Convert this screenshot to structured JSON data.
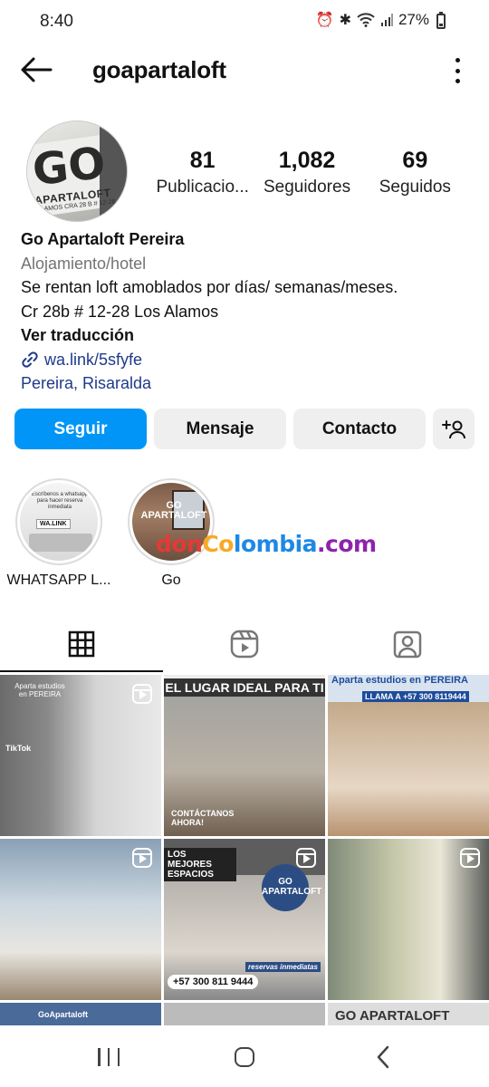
{
  "status": {
    "time": "8:40",
    "battery": "27%"
  },
  "header": {
    "username": "goapartaloft"
  },
  "avatar": {
    "logo_text": "GO",
    "brand": "APARTALOFT",
    "address": "ALAMOS CRA 28 B # 12-28"
  },
  "stats": [
    {
      "value": "81",
      "label": "Publicacio..."
    },
    {
      "value": "1,082",
      "label": "Seguidores"
    },
    {
      "value": "69",
      "label": "Seguidos"
    }
  ],
  "bio": {
    "name": "Go Apartaloft Pereira",
    "category": "Alojamiento/hotel",
    "line1": "Se rentan loft amoblados por días/ semanas/meses.",
    "line2": "Cr 28b # 12-28 Los Alamos",
    "translate": "Ver traducción",
    "link": "wa.link/5sfyfe",
    "location": "Pereira, Risaralda"
  },
  "buttons": {
    "follow": "Seguir",
    "message": "Mensaje",
    "contact": "Contacto"
  },
  "highlights": [
    {
      "label": "WHATSAPP L...",
      "thumb_text": "Escríbenos a whatsapp para hacer reserva inmediata",
      "thumb_badge": "WA.LINK"
    },
    {
      "label": "Go",
      "thumb_text": "GO APARTALOFT"
    }
  ],
  "watermark": {
    "p1": "don",
    "p2": "Co",
    "p3": "lombia",
    "p4": ".com"
  },
  "posts": [
    {
      "caption": "Aparta estudios en PEREIRA",
      "extra": "TikTok"
    },
    {
      "caption": "EL LUGAR IDEAL PARA TI",
      "extra": "CONTÁCTANOS AHORA!"
    },
    {
      "caption": "Aparta estudios en PEREIRA",
      "extra": "LLAMA A +57 300 8119444"
    },
    {
      "caption": "",
      "extra": ""
    },
    {
      "caption": "LOS MEJORES ESPACIOS",
      "extra": "+57 300 811 9444",
      "badge": "GO APARTALOFT",
      "note": "reservas inmediatas"
    },
    {
      "caption": "",
      "extra": ""
    },
    {
      "caption": "GoApartaloft",
      "extra": ""
    },
    {
      "caption": "",
      "extra": ""
    },
    {
      "caption": "GO APARTALOFT",
      "extra": ""
    }
  ],
  "colors": {
    "accent": "#0095f6",
    "link": "#1e3a8a",
    "muted": "#737373"
  }
}
